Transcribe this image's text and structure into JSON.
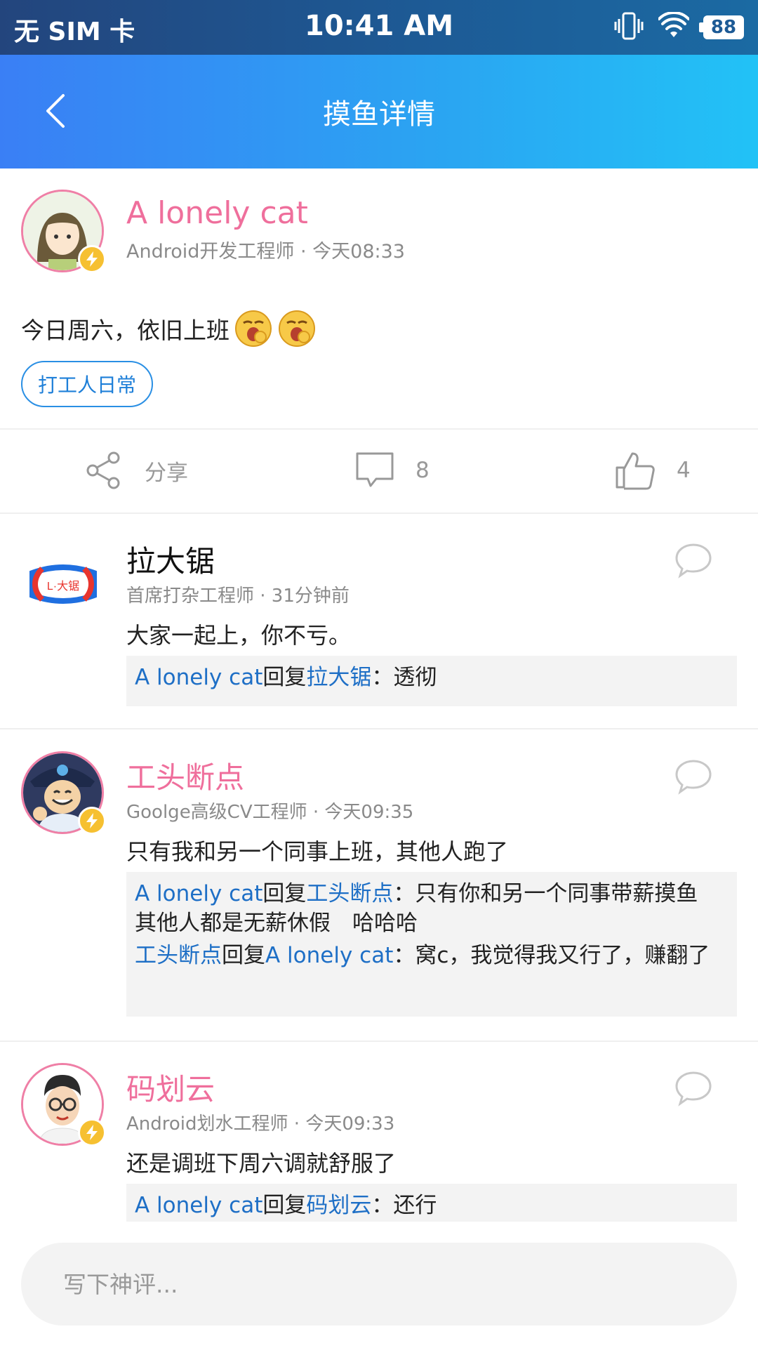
{
  "status_bar": {
    "carrier": "无 SIM 卡",
    "time": "10:41 AM",
    "battery": "88"
  },
  "header": {
    "title": "摸鱼详情"
  },
  "post": {
    "author": "A lonely cat",
    "meta": "Android开发工程师 · 今天08:33",
    "text": "今日周六，依旧上班",
    "tag": "打工人日常",
    "share_label": "分享",
    "comment_count": "8",
    "like_count": "4"
  },
  "comments": [
    {
      "name": "拉大锯",
      "meta": "首席打杂工程师 · 31分钟前",
      "text": "大家一起上，你不亏。",
      "replies": [
        {
          "from": "A lonely cat",
          "verb": "回复",
          "to": "拉大锯",
          "text": "：透彻"
        }
      ]
    },
    {
      "name": "工头断点",
      "meta": "Goolge高级CV工程师 · 今天09:35",
      "text": "只有我和另一个同事上班，其他人跑了",
      "replies": [
        {
          "from": "A lonely cat",
          "verb": "回复",
          "to": "工头断点",
          "text": "：只有你和另一个同事带薪摸鱼　其他人都是无薪休假　哈哈哈"
        },
        {
          "from": "工头断点",
          "verb": "回复",
          "to": "A lonely cat",
          "text": "：窝c，我觉得我又行了，赚翻了"
        }
      ]
    },
    {
      "name": "码划云",
      "meta": "Android划水工程师 · 今天09:33",
      "text": "还是调班下周六调就舒服了",
      "replies": [
        {
          "from": "A lonely cat",
          "verb": "回复",
          "to": "码划云",
          "text": "：还行"
        }
      ]
    }
  ],
  "input": {
    "placeholder": "写下神评..."
  },
  "colors": {
    "header_start": "#3a7ff5",
    "header_end": "#22c2f6",
    "name_pink": "#ef6f9c",
    "link_blue": "#1e6fc6",
    "badge_yellow": "#f6c031"
  },
  "icons": [
    "back-icon",
    "vibrate-icon",
    "wifi-icon",
    "battery-icon",
    "share-icon",
    "comment-icon",
    "like-icon",
    "reply-icon",
    "verified-badge-icon"
  ]
}
